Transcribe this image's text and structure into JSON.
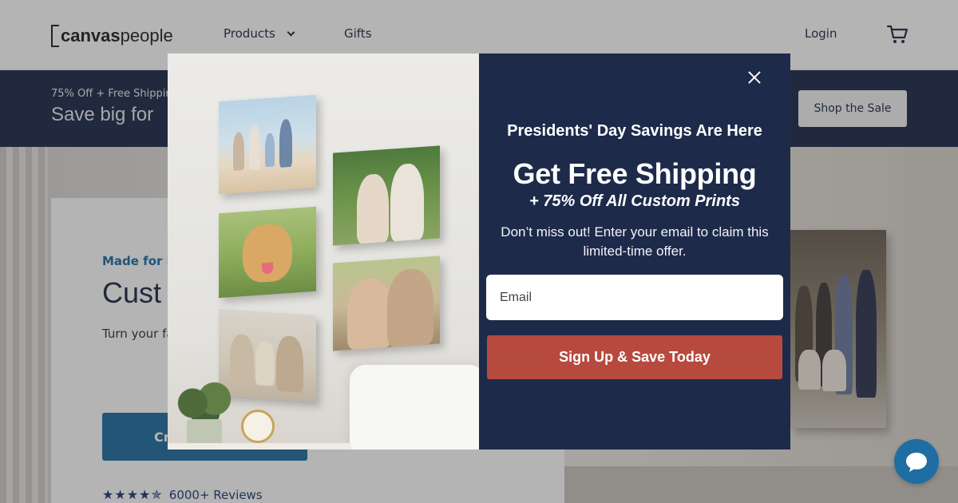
{
  "header": {
    "logo_bold": "canvas",
    "logo_light": "people",
    "nav": [
      {
        "label": "Products"
      },
      {
        "label": "Gifts"
      }
    ],
    "login_label": "Login",
    "cart_icon": "cart-icon"
  },
  "banner": {
    "small_text": "75% Off + Free Shippin",
    "big_text": "Save big for",
    "button_label": "Shop the Sale"
  },
  "hero": {
    "eyebrow": "Made for l",
    "title": "Cust",
    "text": "Turn your fa your size, cu onto.",
    "cta_label": "Cr",
    "stars": "★★★★✯",
    "reviews_label": "6000+ Reviews"
  },
  "modal": {
    "headline": "Presidents' Day Savings Are Here",
    "title": "Get Free Shipping",
    "subtitle": "+ 75% Off All Custom Prints",
    "description": "Don’t miss out! Enter your email to claim this limited-time offer.",
    "email_placeholder": "Email",
    "email_value": "",
    "submit_label": "Sign Up & Save Today",
    "close_icon": "close-icon"
  },
  "chat": {
    "icon": "chat-bubble-icon"
  },
  "colors": {
    "navy": "#1e2a4a",
    "accent_blue": "#1f6ea3",
    "cta_red": "#b74a3e",
    "overlay": "rgba(40,40,40,0.35)"
  }
}
